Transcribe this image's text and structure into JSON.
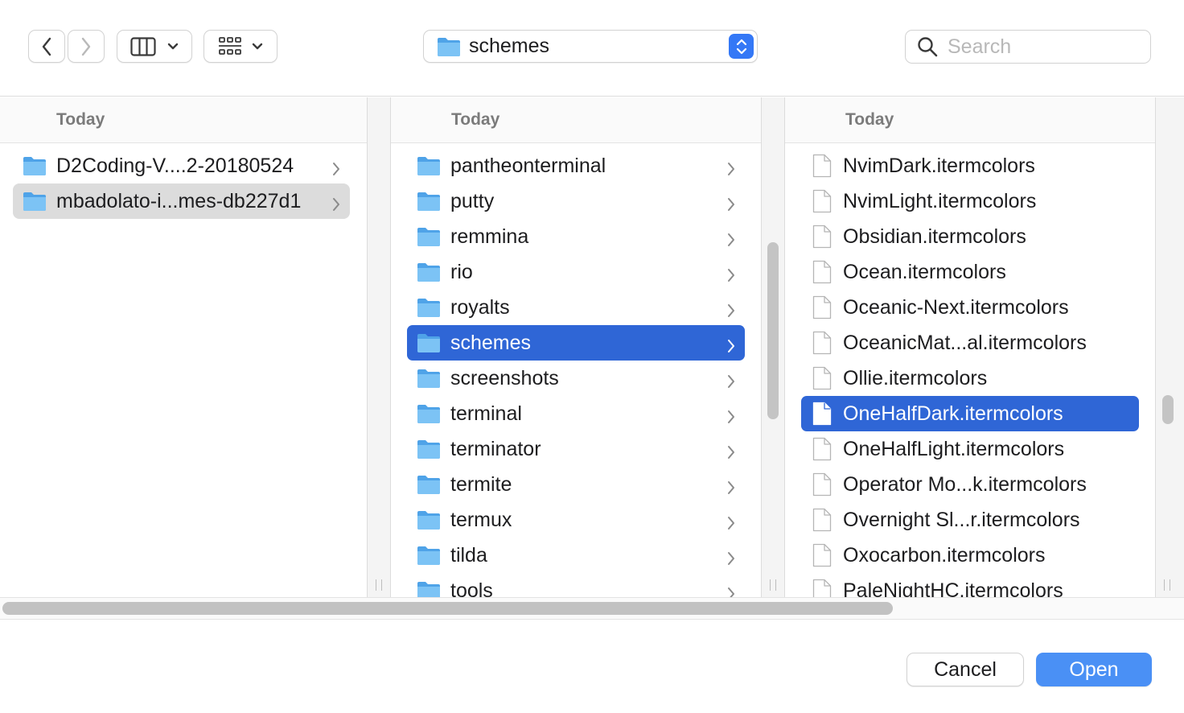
{
  "toolbar": {
    "back_icon": "chevron-left-icon",
    "forward_icon": "chevron-right-icon",
    "view_icon": "column-view-icon",
    "group_icon": "grid-group-icon",
    "path": "schemes",
    "search_placeholder": "Search"
  },
  "columns": [
    {
      "header": "Today",
      "items": [
        {
          "label": "D2Coding-V....2-20180524",
          "type": "folder",
          "selected": ""
        },
        {
          "label": "mbadolato-i...mes-db227d1",
          "type": "folder",
          "selected": "gray"
        }
      ]
    },
    {
      "header": "Today",
      "items": [
        {
          "label": "pantheonterminal",
          "type": "folder",
          "selected": ""
        },
        {
          "label": "putty",
          "type": "folder",
          "selected": ""
        },
        {
          "label": "remmina",
          "type": "folder",
          "selected": ""
        },
        {
          "label": "rio",
          "type": "folder",
          "selected": ""
        },
        {
          "label": "royalts",
          "type": "folder",
          "selected": ""
        },
        {
          "label": "schemes",
          "type": "folder",
          "selected": "blue"
        },
        {
          "label": "screenshots",
          "type": "folder",
          "selected": ""
        },
        {
          "label": "terminal",
          "type": "folder",
          "selected": ""
        },
        {
          "label": "terminator",
          "type": "folder",
          "selected": ""
        },
        {
          "label": "termite",
          "type": "folder",
          "selected": ""
        },
        {
          "label": "termux",
          "type": "folder",
          "selected": ""
        },
        {
          "label": "tilda",
          "type": "folder",
          "selected": ""
        },
        {
          "label": "tools",
          "type": "folder",
          "selected": ""
        }
      ]
    },
    {
      "header": "Today",
      "items": [
        {
          "label": "NvimDark.itermcolors",
          "type": "file",
          "selected": ""
        },
        {
          "label": "NvimLight.itermcolors",
          "type": "file",
          "selected": ""
        },
        {
          "label": "Obsidian.itermcolors",
          "type": "file",
          "selected": ""
        },
        {
          "label": "Ocean.itermcolors",
          "type": "file",
          "selected": ""
        },
        {
          "label": "Oceanic-Next.itermcolors",
          "type": "file",
          "selected": ""
        },
        {
          "label": "OceanicMat...al.itermcolors",
          "type": "file",
          "selected": ""
        },
        {
          "label": "Ollie.itermcolors",
          "type": "file",
          "selected": ""
        },
        {
          "label": "OneHalfDark.itermcolors",
          "type": "file",
          "selected": "blue"
        },
        {
          "label": "OneHalfLight.itermcolors",
          "type": "file",
          "selected": ""
        },
        {
          "label": "Operator Mo...k.itermcolors",
          "type": "file",
          "selected": ""
        },
        {
          "label": "Overnight Sl...r.itermcolors",
          "type": "file",
          "selected": ""
        },
        {
          "label": "Oxocarbon.itermcolors",
          "type": "file",
          "selected": ""
        },
        {
          "label": "PaleNightHC.itermcolors",
          "type": "file",
          "selected": ""
        }
      ]
    }
  ],
  "footer": {
    "cancel_label": "Cancel",
    "open_label": "Open"
  },
  "colors": {
    "selection_blue": "#2f66d6",
    "selection_gray": "#dcdcdc",
    "accent": "#4a90f5",
    "folder": "#5fb0ee"
  }
}
